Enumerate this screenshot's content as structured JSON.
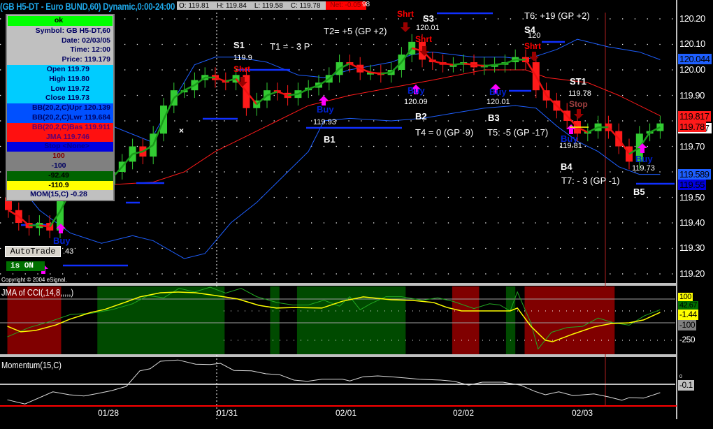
{
  "header": {
    "title": "(GB H5-DT - Euro BUND,60) Dynamic,0:00-24:00",
    "open": "O: 119.81",
    "high": "H: 119.84",
    "low": "L: 119.58",
    "close": "C: 119.78",
    "net": "Net: -0.05",
    "extra": "98"
  },
  "info_box": {
    "status": "ok",
    "symbol": "Symbol: GB H5-DT,60",
    "date": "Date: 02/03/05",
    "time": "Time: 12:00",
    "price": "Price: 119.179",
    "open": "Open 119.79",
    "high": "High 119.80",
    "low": "Low 119.72",
    "close": "Close 119.73",
    "bb_upper": "BB(20,2,C)Upr 120.139",
    "bb_lower": "BB(20,2,C)Lwr 119.684",
    "bb_basis": "BB(20,2,C)Bas 119.911",
    "jma": "JMA 119.746",
    "stop": "Stop <None>",
    "cci_upper": "100",
    "cci_lower": "-100",
    "cci_value": "-92.49",
    "jma_cci": "-110.9",
    "momentum": "MOM(15,C) -0.28"
  },
  "autotrade": {
    "button": "AutoTrade",
    "status": "is ON"
  },
  "copyright": "Copyright © 2004 eSignal.",
  "annotations": [
    "S1",
    "119.9",
    "Shrt",
    "T1 = - 3 P",
    "T2= +5 (GP +2)",
    "Shrt",
    "S3",
    "120.01",
    "Shrt",
    "Buy",
    "119.93",
    "B1",
    "Buy",
    "120.09",
    "B2",
    "T4 = 0 (GP -9)",
    "Buy",
    "120.01",
    "B3",
    "T5: -5 (GP -17)",
    "T6: +19 (GP +2)",
    "S4",
    "120",
    "Shrt",
    "ST1",
    "119.78",
    "Stop",
    "Buy",
    "119.81",
    "B4",
    "T7: - 3 (GP -1)",
    "Buy",
    "119.73",
    "B5",
    "Buy",
    ".43"
  ],
  "price_axis": {
    "ticks": [
      "120.20",
      "120.10",
      "120.00",
      "119.90",
      "119.70",
      "119.50",
      "119.40",
      "119.30",
      "119.20"
    ],
    "badges": {
      "upper_band": "120.044",
      "basis": "119.817",
      "last_under": "119.787",
      "last": "119.78",
      "lower_band": "119.589",
      "stop": "119.55"
    }
  },
  "cci_pane": {
    "label": "JMA of CCI(,14,8,,,,,)",
    "axis": {
      "upper": "100",
      "cci": "42.67",
      "jma": "-1.44",
      "lower": "-100",
      "floor": "-250"
    }
  },
  "momentum_pane": {
    "label": "Momentum(15,C)",
    "axis": {
      "zero": "0",
      "value": "-0.1"
    }
  },
  "dates": [
    "01/28",
    "01/31",
    "02/01",
    "02/02",
    "02/03"
  ],
  "colors": {
    "up": "#33cc33",
    "down": "#ff1a1a",
    "band": "#1e5fff",
    "basis": "#ff1a1a",
    "cci": "#22aa22",
    "jma": "#ffff00",
    "green_zone": "#004a00",
    "red_zone": "#800000"
  },
  "chart_data": {
    "type": "candlestick",
    "price_range": [
      119.2,
      120.2
    ],
    "closes": [
      119.45,
      119.4,
      119.38,
      119.4,
      119.37,
      119.52,
      119.53,
      119.53,
      119.54,
      119.55,
      119.6,
      119.64,
      119.7,
      119.66,
      119.75,
      119.86,
      119.92,
      119.92,
      119.96,
      119.98,
      119.96,
      119.95,
      119.98,
      119.85,
      119.88,
      119.92,
      119.91,
      119.89,
      119.92,
      119.93,
      119.95,
      119.98,
      120.03,
      120.02,
      119.99,
      119.99,
      119.98,
      120.0,
      120.06,
      120.11,
      120.04,
      120.03,
      120.02,
      120.02,
      120.03,
      120.01,
      120.02,
      120.02,
      120.03,
      120.05,
      120.03,
      119.92,
      119.88,
      119.84,
      119.8,
      119.75,
      119.76,
      119.79,
      119.76,
      119.7,
      119.64,
      119.75,
      119.76,
      119.79
    ],
    "bb_upper": [
      [
        0,
        119.82
      ],
      [
        6,
        119.8
      ],
      [
        10,
        119.78
      ],
      [
        13.7,
        119.72
      ],
      [
        15.5,
        119.85
      ],
      [
        18,
        120.02
      ],
      [
        20,
        120.05
      ],
      [
        22,
        120.05
      ],
      [
        25,
        120.03
      ],
      [
        28,
        119.98
      ],
      [
        30.5,
        119.97
      ],
      [
        33,
        120.0
      ],
      [
        37,
        120.03
      ],
      [
        39,
        120.06
      ],
      [
        41,
        120.07
      ],
      [
        45,
        120.05
      ],
      [
        48,
        120.05
      ],
      [
        50,
        120.04
      ],
      [
        53,
        120.08
      ],
      [
        55,
        120.12
      ],
      [
        58,
        120.09
      ],
      [
        61,
        120.07
      ],
      [
        63,
        120.04
      ]
    ],
    "bb_lower": [
      [
        0,
        119.6
      ],
      [
        3,
        119.45
      ],
      [
        6,
        119.36
      ],
      [
        9,
        119.32
      ],
      [
        12,
        119.35
      ],
      [
        14,
        119.33
      ],
      [
        17,
        119.26
      ],
      [
        19,
        119.28
      ],
      [
        21.5,
        119.4
      ],
      [
        24,
        119.48
      ],
      [
        27,
        119.6
      ],
      [
        29,
        119.68
      ],
      [
        30.5,
        119.8
      ],
      [
        33,
        119.81
      ],
      [
        37,
        119.8
      ],
      [
        40,
        119.81
      ],
      [
        43,
        119.83
      ],
      [
        46,
        119.85
      ],
      [
        49,
        119.86
      ],
      [
        51,
        119.85
      ],
      [
        53,
        119.78
      ],
      [
        55,
        119.72
      ],
      [
        57,
        119.68
      ],
      [
        59,
        119.62
      ],
      [
        61,
        119.59
      ],
      [
        63,
        119.59
      ]
    ],
    "bb_basis": [
      [
        0,
        119.5
      ],
      [
        5,
        119.52
      ],
      [
        10,
        119.55
      ],
      [
        14,
        119.56
      ],
      [
        17,
        119.6
      ],
      [
        20,
        119.68
      ],
      [
        23,
        119.74
      ],
      [
        26,
        119.8
      ],
      [
        29,
        119.86
      ],
      [
        33,
        119.9
      ],
      [
        37,
        119.93
      ],
      [
        41,
        119.96
      ],
      [
        46,
        120.0
      ],
      [
        50,
        120.0
      ],
      [
        52,
        119.97
      ],
      [
        56,
        119.95
      ],
      [
        59,
        119.9
      ],
      [
        63,
        119.82
      ]
    ],
    "cci_zones": [
      {
        "from": -0.1,
        "to": 5.1,
        "state": "red"
      },
      {
        "from": 8.6,
        "to": 20.9,
        "state": "green"
      },
      {
        "from": 25.3,
        "to": 26.2,
        "state": "green"
      },
      {
        "from": 27.9,
        "to": 38.4,
        "state": "green"
      },
      {
        "from": 42.9,
        "to": 45.5,
        "state": "red"
      },
      {
        "from": 48.1,
        "to": 49,
        "state": "green"
      },
      {
        "from": 49.9,
        "to": 58.6,
        "state": "red"
      }
    ],
    "cci": [
      [
        -0.1,
        -218
      ],
      [
        2,
        -140
      ],
      [
        4,
        -90
      ],
      [
        6,
        -30
      ],
      [
        8,
        -20
      ],
      [
        10,
        10
      ],
      [
        12,
        60
      ],
      [
        13.5,
        130
      ],
      [
        15,
        110
      ],
      [
        16.5,
        190
      ],
      [
        18,
        160
      ],
      [
        19.5,
        200
      ],
      [
        21,
        150
      ],
      [
        22.5,
        190
      ],
      [
        24,
        120
      ],
      [
        26,
        70
      ],
      [
        27.5,
        50
      ],
      [
        29,
        50
      ],
      [
        30.5,
        90
      ],
      [
        32,
        40
      ],
      [
        33,
        120
      ],
      [
        34,
        10
      ],
      [
        35,
        60
      ],
      [
        36.5,
        120
      ],
      [
        38,
        120
      ],
      [
        40,
        90
      ],
      [
        41.5,
        110
      ],
      [
        43,
        80
      ],
      [
        45,
        20
      ],
      [
        46.5,
        60
      ],
      [
        47.5,
        50
      ],
      [
        48.5,
        0
      ],
      [
        49.2,
        160
      ],
      [
        50.5,
        -100
      ],
      [
        51.2,
        -320
      ],
      [
        52.5,
        -180
      ],
      [
        54,
        -140
      ],
      [
        55.5,
        -130
      ],
      [
        57,
        -60
      ],
      [
        58.5,
        -100
      ],
      [
        60,
        -120
      ],
      [
        61.5,
        -40
      ],
      [
        63,
        10
      ]
    ],
    "jma_cci": [
      [
        -0.1,
        -129
      ],
      [
        1.2,
        -176
      ],
      [
        2.6,
        -165
      ],
      [
        4.6,
        -118
      ],
      [
        5.9,
        -71
      ],
      [
        8,
        -12
      ],
      [
        9.3,
        12
      ],
      [
        11.4,
        76
      ],
      [
        12.7,
        118
      ],
      [
        14.7,
        153
      ],
      [
        16.4,
        159
      ],
      [
        18.1,
        153
      ],
      [
        20.1,
        129
      ],
      [
        22.2,
        100
      ],
      [
        24.2,
        47
      ],
      [
        25.9,
        24
      ],
      [
        27.6,
        29
      ],
      [
        30.3,
        24
      ],
      [
        32.3,
        82
      ],
      [
        34.3,
        118
      ],
      [
        37,
        94
      ],
      [
        39.1,
        88
      ],
      [
        41.1,
        71
      ],
      [
        42.4,
        29
      ],
      [
        43.8,
        0
      ],
      [
        46.5,
        0
      ],
      [
        48.5,
        0
      ],
      [
        49.2,
        24
      ],
      [
        50.5,
        -129
      ],
      [
        51.9,
        -247
      ],
      [
        52.6,
        -259
      ],
      [
        54.6,
        -194
      ],
      [
        56.6,
        -135
      ],
      [
        58.3,
        -106
      ],
      [
        60,
        -100
      ],
      [
        61.4,
        -76
      ],
      [
        63,
        -12
      ]
    ],
    "momentum": [
      [
        -0.1,
        -0.37
      ],
      [
        1.6,
        -0.47
      ],
      [
        4.3,
        -0.18
      ],
      [
        5.9,
        -0.25
      ],
      [
        7.3,
        -0.28
      ],
      [
        8.6,
        -0.22
      ],
      [
        10,
        -0.15
      ],
      [
        11.4,
        -0.05
      ],
      [
        12.7,
        0.32
      ],
      [
        13.7,
        0.37
      ],
      [
        14.7,
        0.55
      ],
      [
        16.4,
        0.58
      ],
      [
        18.1,
        0.48
      ],
      [
        19.5,
        0.47
      ],
      [
        20.5,
        0.5
      ],
      [
        21.8,
        0.33
      ],
      [
        23.5,
        0.32
      ],
      [
        24.9,
        0.25
      ],
      [
        26.2,
        0.23
      ],
      [
        27.6,
        0.1
      ],
      [
        28.9,
        0.07
      ],
      [
        30.3,
        0.12
      ],
      [
        32.3,
        0.12
      ],
      [
        33,
        0.08
      ],
      [
        34.3,
        0.18
      ],
      [
        35.7,
        0.2
      ],
      [
        37,
        0.18
      ],
      [
        38.4,
        0.15
      ],
      [
        39.7,
        0.12
      ],
      [
        41.8,
        0.1
      ],
      [
        43.1,
        0.07
      ],
      [
        44.5,
        -0.02
      ],
      [
        45.8,
        0.05
      ],
      [
        47.8,
        0.05
      ],
      [
        49.5,
        -0.02
      ],
      [
        50.9,
        -0.17
      ],
      [
        51.9,
        -0.25
      ],
      [
        53.2,
        -0.18
      ],
      [
        54.6,
        -0.27
      ],
      [
        56.6,
        -0.23
      ],
      [
        58,
        -0.3
      ],
      [
        59.3,
        -0.38
      ],
      [
        60,
        -0.32
      ],
      [
        61.4,
        -0.33
      ],
      [
        63,
        -0.2
      ]
    ]
  }
}
